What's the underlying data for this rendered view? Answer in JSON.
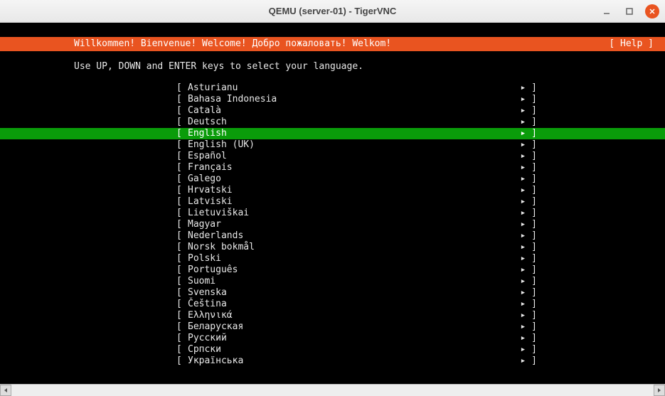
{
  "window": {
    "title": "QEMU (server-01) - TigerVNC"
  },
  "header": {
    "welcome": "Willkommen! Bienvenue! Welcome! Добро пожаловать! Welkom!",
    "help": "[ Help ]"
  },
  "instruction": "Use UP, DOWN and ENTER keys to select your language.",
  "selected_index": 4,
  "languages": [
    "Asturianu",
    "Bahasa Indonesia",
    "Català",
    "Deutsch",
    "English",
    "English (UK)",
    "Español",
    "Français",
    "Galego",
    "Hrvatski",
    "Latviski",
    "Lietuviškai",
    "Magyar",
    "Nederlands",
    "Norsk bokmål",
    "Polski",
    "Português",
    "Suomi",
    "Svenska",
    "Čeština",
    "Ελληνικά",
    "Беларуская",
    "Русский",
    "Српски",
    "Українська"
  ]
}
